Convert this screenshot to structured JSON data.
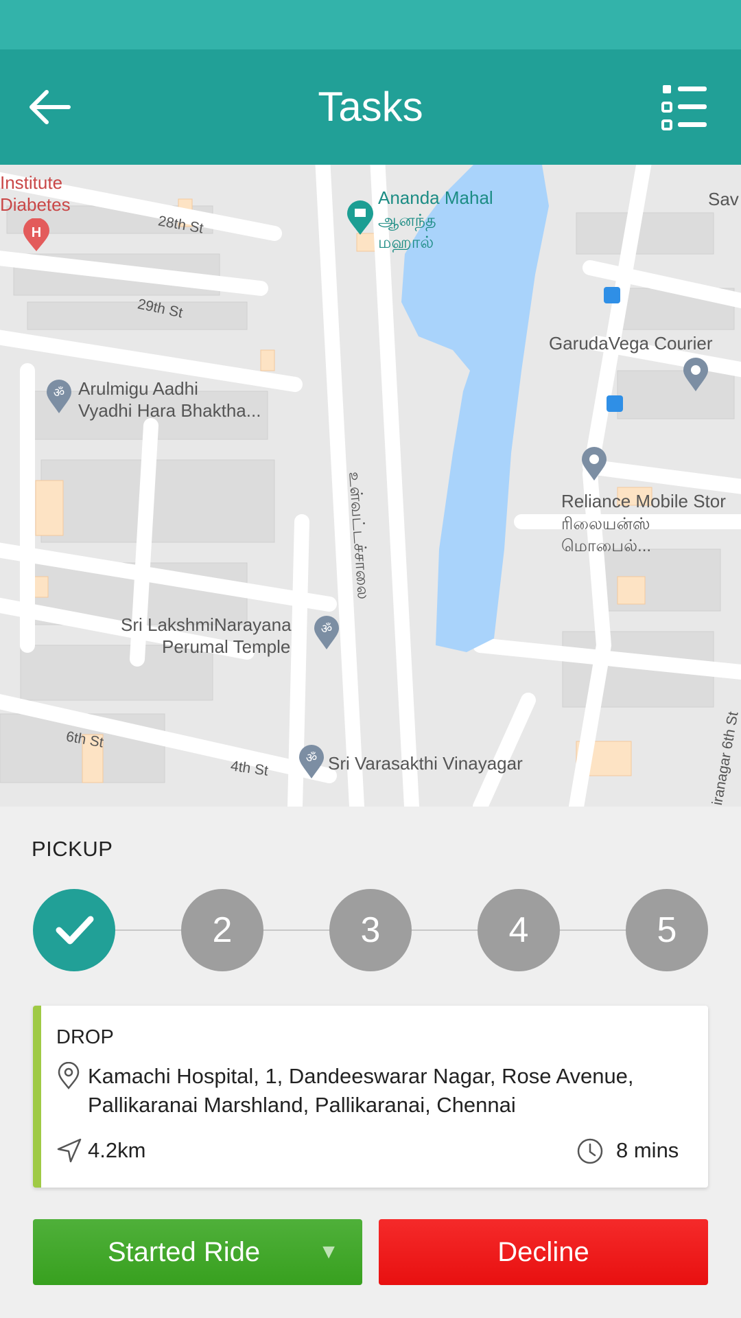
{
  "status_bar": {
    "color": "#33b3aa"
  },
  "header": {
    "title": "Tasks",
    "back_icon": "arrow-left-icon",
    "menu_icon": "task-list-icon",
    "color": "#21a097"
  },
  "map": {
    "places": {
      "institute": "Institute",
      "diabetes": "Diabetes",
      "ananda_en": "Ananda Mahal",
      "ananda_ta1": "ஆனந்த",
      "ananda_ta2": "மஹால்",
      "sav": "Sav",
      "garuda": "GarudaVega Courier",
      "arulmigu1": "Arulmigu Aadhi",
      "arulmigu2": "Vyadhi Hara Bhaktha...",
      "reliance_en": "Reliance Mobile Stor",
      "reliance_ta1": "ரிலையன்ஸ்",
      "reliance_ta2": "மொபைல்...",
      "lakshmi1": "Sri LakshmiNarayana",
      "lakshmi2": "Perumal Temple",
      "varasakthi": "Sri Varasakthi Vinayagar"
    },
    "streets": {
      "st28": "28th St",
      "st29": "29th St",
      "st6": "6th St",
      "st4": "4th St",
      "inner_road": "உள்வட்டச்சாலை",
      "nagar6": "iranagar 6th St"
    }
  },
  "pickup": {
    "label": "PICKUP",
    "steps": [
      "✓",
      "2",
      "3",
      "4",
      "5"
    ],
    "active_color": "#21a097",
    "inactive_color": "#9e9e9e"
  },
  "drop_card": {
    "label": "DROP",
    "address": "Kamachi Hospital, 1, Dandeeswarar Nagar, Rose Avenue, Pallikaranai Marshland, Pallikaranai, Chennai",
    "distance": "4.2km",
    "duration": "8 mins",
    "accent_color": "#9fca45"
  },
  "actions": {
    "start_label": "Started Ride",
    "start_caret": "▼",
    "decline_label": "Decline",
    "start_color": "#3fa528",
    "decline_color": "#ee1a1a"
  }
}
